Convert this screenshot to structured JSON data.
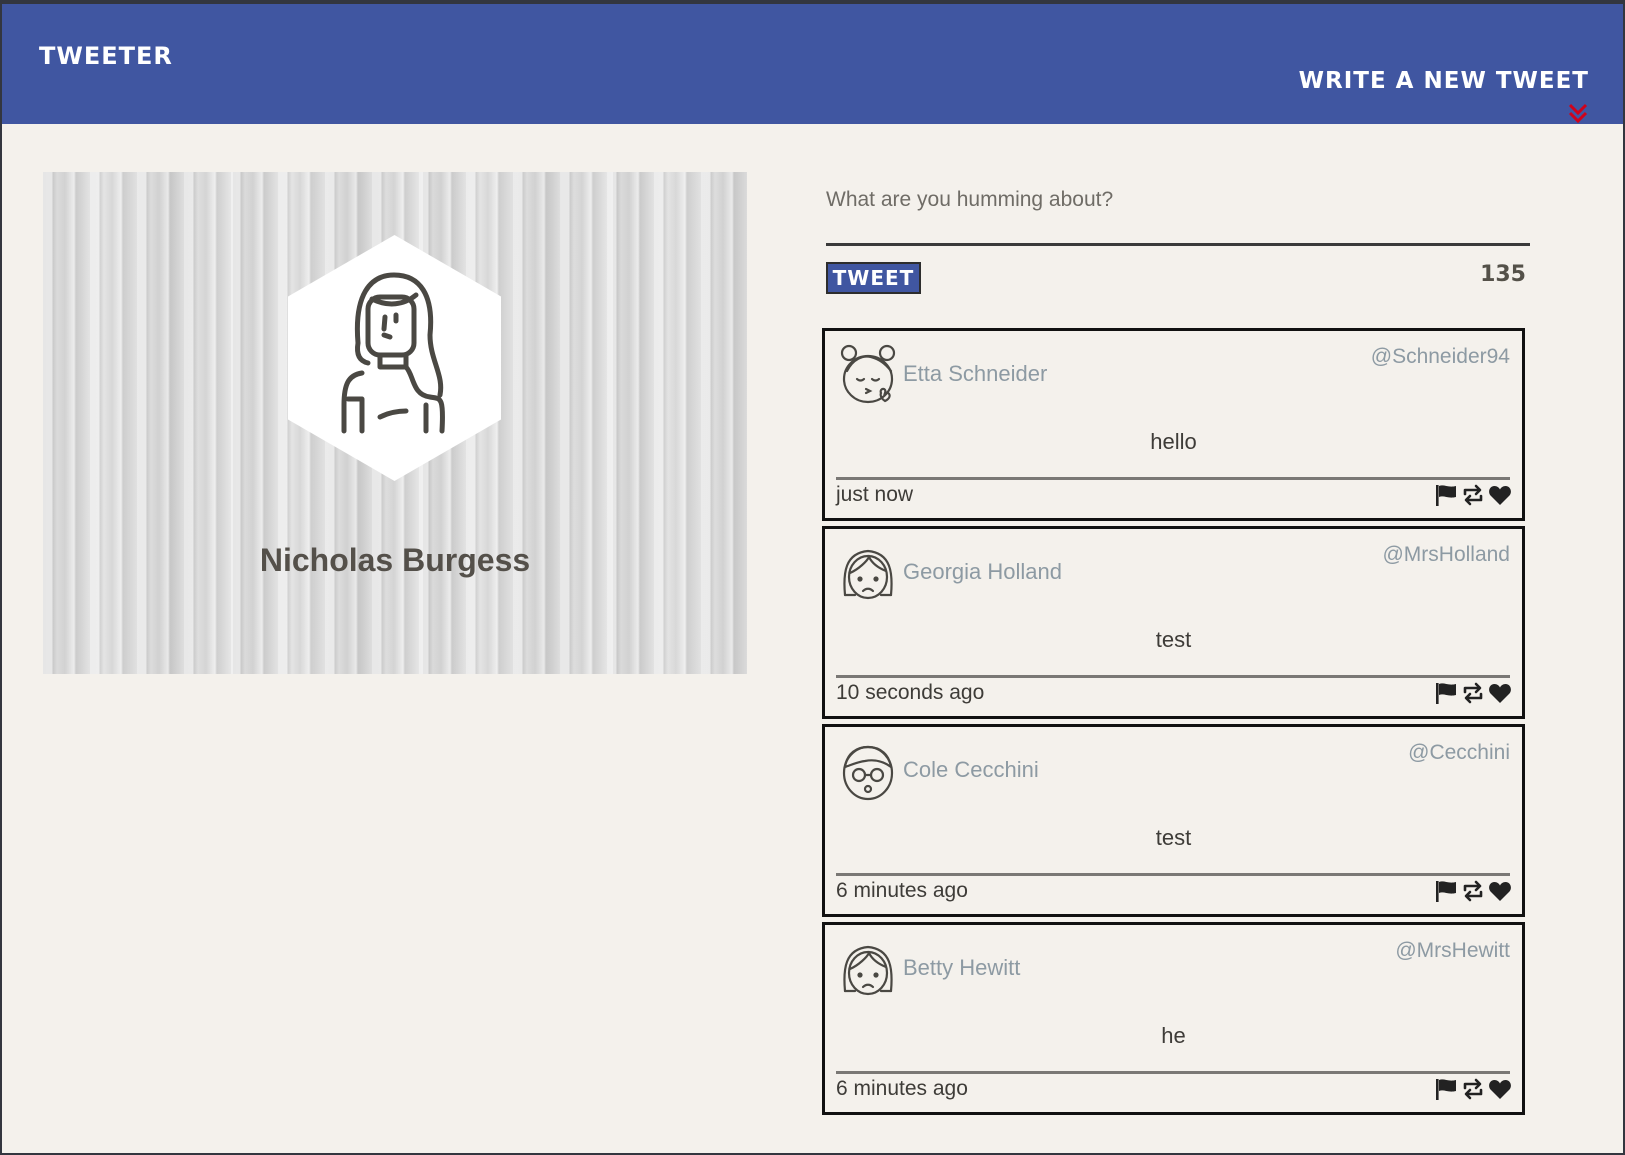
{
  "nav": {
    "brand": "TWEETER",
    "compose_toggle": "WRITE A NEW TWEET",
    "chevron_color": "#d0021b",
    "background": "#4056a1"
  },
  "profile": {
    "name": "Nicholas Burgess",
    "avatar_icon": "user-avatar-icon"
  },
  "compose": {
    "placeholder": "What are you humming about?",
    "value": "",
    "button_label": "TWEET",
    "char_counter": "135"
  },
  "tweets": [
    {
      "author": "Etta Schneider",
      "handle": "@Schneider94",
      "text": "hello",
      "time": "just now",
      "avatar_icon": "girl-kiss-avatar-icon"
    },
    {
      "author": "Georgia Holland",
      "handle": "@MrsHolland",
      "text": "test",
      "time": "10 seconds ago",
      "avatar_icon": "woman-frown-avatar-icon"
    },
    {
      "author": "Cole Cecchini",
      "handle": "@Cecchini",
      "text": "test",
      "time": "6 minutes ago",
      "avatar_icon": "man-glasses-avatar-icon"
    },
    {
      "author": "Betty Hewitt",
      "handle": "@MrsHewitt",
      "text": "he",
      "time": "6 minutes ago",
      "avatar_icon": "woman-frown-avatar-icon"
    }
  ],
  "tweet_actions": [
    "flag-icon",
    "retweet-icon",
    "heart-icon"
  ]
}
